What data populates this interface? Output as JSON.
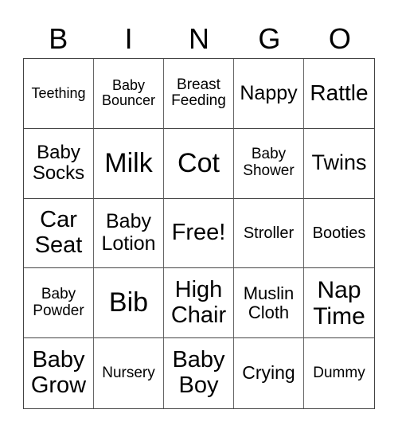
{
  "header": [
    "B",
    "I",
    "N",
    "G",
    "O"
  ],
  "cells": [
    {
      "text": "Teething",
      "size": 18
    },
    {
      "text": "Baby Bouncer",
      "size": 18
    },
    {
      "text": "Breast Feeding",
      "size": 19
    },
    {
      "text": "Nappy",
      "size": 25
    },
    {
      "text": "Rattle",
      "size": 28
    },
    {
      "text": "Baby Socks",
      "size": 24
    },
    {
      "text": "Milk",
      "size": 34
    },
    {
      "text": "Cot",
      "size": 34
    },
    {
      "text": "Baby Shower",
      "size": 19
    },
    {
      "text": "Twins",
      "size": 27
    },
    {
      "text": "Car Seat",
      "size": 29
    },
    {
      "text": "Baby Lotion",
      "size": 25
    },
    {
      "text": "Free!",
      "size": 29
    },
    {
      "text": "Stroller",
      "size": 20
    },
    {
      "text": "Booties",
      "size": 20
    },
    {
      "text": "Baby Powder",
      "size": 19
    },
    {
      "text": "Bib",
      "size": 34
    },
    {
      "text": "High Chair",
      "size": 29
    },
    {
      "text": "Muslin Cloth",
      "size": 22
    },
    {
      "text": "Nap Time",
      "size": 30
    },
    {
      "text": "Baby Grow",
      "size": 29
    },
    {
      "text": "Nursery",
      "size": 19
    },
    {
      "text": "Baby Boy",
      "size": 29
    },
    {
      "text": "Crying",
      "size": 23
    },
    {
      "text": "Dummy",
      "size": 19
    }
  ]
}
